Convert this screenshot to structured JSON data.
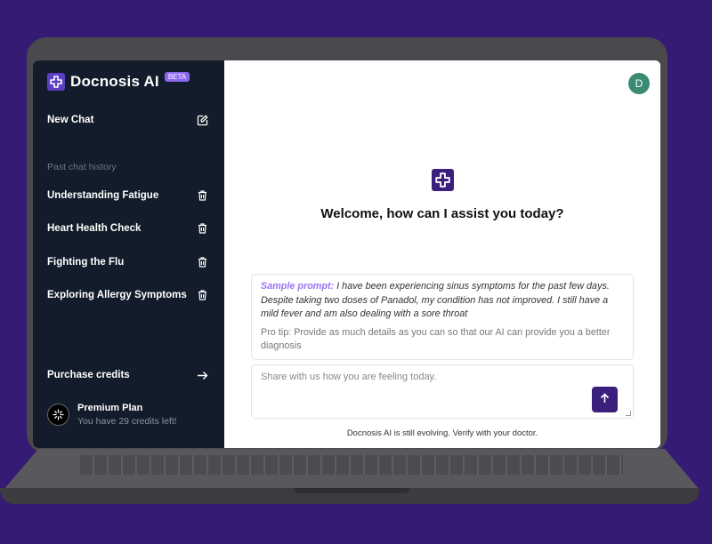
{
  "app": {
    "name": "Docnosis AI",
    "badge": "BETA"
  },
  "sidebar": {
    "new_chat_label": "New Chat",
    "history_label": "Past chat history",
    "history": [
      {
        "label": "Understanding Fatigue"
      },
      {
        "label": "Heart Health Check"
      },
      {
        "label": "Fighting the Flu"
      },
      {
        "label": "Exploring Allergy Symptoms"
      }
    ],
    "purchase_label": "Purchase credits",
    "plan": {
      "title": "Premium Plan",
      "subtitle": "You have 29 credits left!"
    }
  },
  "header": {
    "avatar_initial": "D"
  },
  "main": {
    "welcome": "Welcome, how can I assist you today?",
    "sample_label": "Sample prompt:",
    "sample_text": " I have been experiencing sinus symptoms for the past few days. Despite taking two doses of Panadol, my condition has not improved. I still have a mild fever and am also dealing with a sore throat",
    "tip": "Pro tip: Provide as much details as you can so that our AI can provide you a better diagnosis",
    "input_placeholder": "Share with us how you are feeling today.",
    "disclaimer": "Docnosis AI is still evolving. Verify with your doctor."
  },
  "icons": {
    "logo": "medical-cross-icon",
    "new_chat": "edit-icon",
    "delete": "trash-icon",
    "purchase": "arrow-right-icon",
    "plan": "sparkle-icon",
    "send": "arrow-up-icon"
  },
  "colors": {
    "background": "#351b73",
    "sidebar": "#131c2a",
    "accent": "#3b1f7c",
    "beta_badge": "#8b68ee",
    "sample_label": "#9a73f2",
    "avatar": "#3b8a73"
  }
}
